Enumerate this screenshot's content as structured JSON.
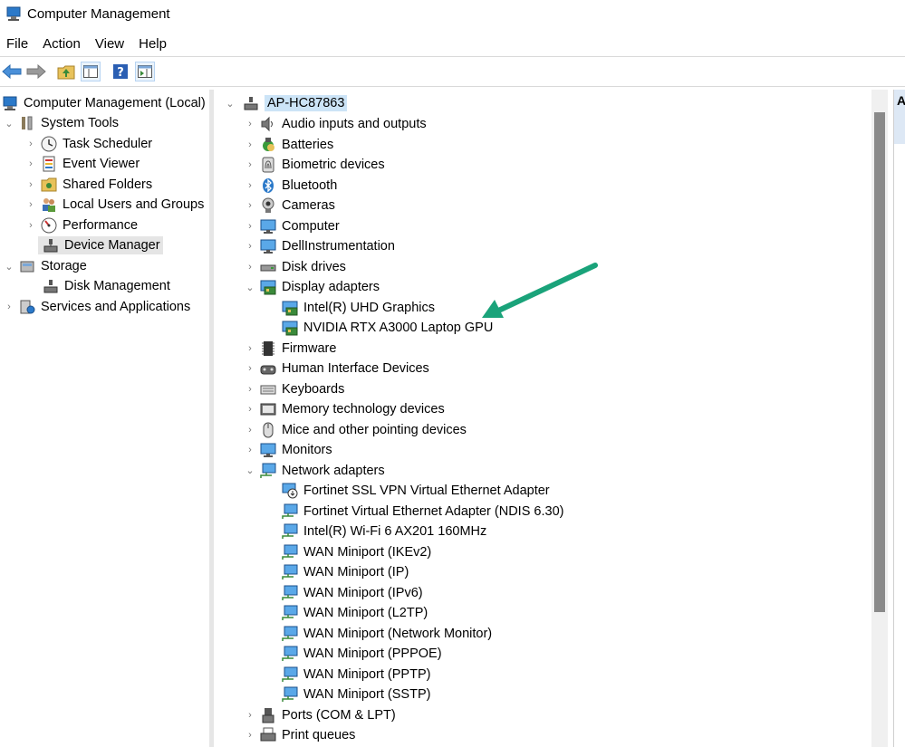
{
  "window": {
    "title": "Computer Management"
  },
  "menu": [
    "File",
    "Action",
    "View",
    "Help"
  ],
  "colors": {
    "annotation_arrow": "#1aa37a",
    "selection": "#cce4f7",
    "icon_blue": "#2b79c9"
  },
  "left_tree": [
    {
      "label": "Computer Management (Local)",
      "icon": "computer-management-icon",
      "expander": "none",
      "level": 0
    },
    {
      "label": "System Tools",
      "icon": "tools-icon",
      "expander": "expanded",
      "level": 0
    },
    {
      "label": "Task Scheduler",
      "icon": "clock-icon",
      "expander": "collapsed",
      "level": 1
    },
    {
      "label": "Event Viewer",
      "icon": "event-viewer-icon",
      "expander": "collapsed",
      "level": 1
    },
    {
      "label": "Shared Folders",
      "icon": "shared-folder-icon",
      "expander": "collapsed",
      "level": 1
    },
    {
      "label": "Local Users and Groups",
      "icon": "users-icon",
      "expander": "collapsed",
      "level": 1
    },
    {
      "label": "Performance",
      "icon": "performance-icon",
      "expander": "collapsed",
      "level": 1
    },
    {
      "label": "Device Manager",
      "icon": "device-manager-icon",
      "expander": "none",
      "level": 1,
      "selected": true
    },
    {
      "label": "Storage",
      "icon": "storage-icon",
      "expander": "expanded",
      "level": 0
    },
    {
      "label": "Disk Management",
      "icon": "disk-management-icon",
      "expander": "none",
      "level": 1
    },
    {
      "label": "Services and Applications",
      "icon": "services-icon",
      "expander": "collapsed",
      "level": 0
    }
  ],
  "device_tree": {
    "root": "AP-HC87863",
    "items": [
      {
        "label": "Audio inputs and outputs",
        "icon": "speaker-icon",
        "level": 0,
        "expander": "collapsed"
      },
      {
        "label": "Batteries",
        "icon": "battery-icon",
        "level": 0,
        "expander": "collapsed"
      },
      {
        "label": "Biometric devices",
        "icon": "fingerprint-icon",
        "level": 0,
        "expander": "collapsed"
      },
      {
        "label": "Bluetooth",
        "icon": "bluetooth-icon",
        "level": 0,
        "expander": "collapsed"
      },
      {
        "label": "Cameras",
        "icon": "camera-icon",
        "level": 0,
        "expander": "collapsed"
      },
      {
        "label": "Computer",
        "icon": "monitor-icon",
        "level": 0,
        "expander": "collapsed"
      },
      {
        "label": "DellInstrumentation",
        "icon": "monitor-icon",
        "level": 0,
        "expander": "collapsed"
      },
      {
        "label": "Disk drives",
        "icon": "disk-drive-icon",
        "level": 0,
        "expander": "collapsed"
      },
      {
        "label": "Display adapters",
        "icon": "display-adapter-icon",
        "level": 0,
        "expander": "expanded"
      },
      {
        "label": "Intel(R) UHD Graphics",
        "icon": "display-adapter-icon",
        "level": 1,
        "expander": "none"
      },
      {
        "label": "NVIDIA RTX A3000 Laptop GPU",
        "icon": "display-adapter-icon",
        "level": 1,
        "expander": "none"
      },
      {
        "label": "Firmware",
        "icon": "chip-icon",
        "level": 0,
        "expander": "collapsed"
      },
      {
        "label": "Human Interface Devices",
        "icon": "hid-icon",
        "level": 0,
        "expander": "collapsed"
      },
      {
        "label": "Keyboards",
        "icon": "keyboard-icon",
        "level": 0,
        "expander": "collapsed"
      },
      {
        "label": "Memory technology devices",
        "icon": "memory-icon",
        "level": 0,
        "expander": "collapsed"
      },
      {
        "label": "Mice and other pointing devices",
        "icon": "mouse-icon",
        "level": 0,
        "expander": "collapsed"
      },
      {
        "label": "Monitors",
        "icon": "monitor-icon",
        "level": 0,
        "expander": "collapsed"
      },
      {
        "label": "Network adapters",
        "icon": "network-icon",
        "level": 0,
        "expander": "expanded"
      },
      {
        "label": "Fortinet SSL VPN Virtual Ethernet Adapter",
        "icon": "network-download-icon",
        "level": 1,
        "expander": "none"
      },
      {
        "label": "Fortinet Virtual Ethernet Adapter (NDIS 6.30)",
        "icon": "network-icon",
        "level": 1,
        "expander": "none"
      },
      {
        "label": "Intel(R) Wi-Fi 6 AX201 160MHz",
        "icon": "network-icon",
        "level": 1,
        "expander": "none"
      },
      {
        "label": "WAN Miniport (IKEv2)",
        "icon": "network-icon",
        "level": 1,
        "expander": "none"
      },
      {
        "label": "WAN Miniport (IP)",
        "icon": "network-icon",
        "level": 1,
        "expander": "none"
      },
      {
        "label": "WAN Miniport (IPv6)",
        "icon": "network-icon",
        "level": 1,
        "expander": "none"
      },
      {
        "label": "WAN Miniport (L2TP)",
        "icon": "network-icon",
        "level": 1,
        "expander": "none"
      },
      {
        "label": "WAN Miniport (Network Monitor)",
        "icon": "network-icon",
        "level": 1,
        "expander": "none"
      },
      {
        "label": "WAN Miniport (PPPOE)",
        "icon": "network-icon",
        "level": 1,
        "expander": "none"
      },
      {
        "label": "WAN Miniport (PPTP)",
        "icon": "network-icon",
        "level": 1,
        "expander": "none"
      },
      {
        "label": "WAN Miniport (SSTP)",
        "icon": "network-icon",
        "level": 1,
        "expander": "none"
      },
      {
        "label": "Ports (COM & LPT)",
        "icon": "port-icon",
        "level": 0,
        "expander": "collapsed"
      },
      {
        "label": "Print queues",
        "icon": "printer-icon",
        "level": 0,
        "expander": "collapsed"
      }
    ]
  },
  "right_pane": {
    "header": "A"
  }
}
